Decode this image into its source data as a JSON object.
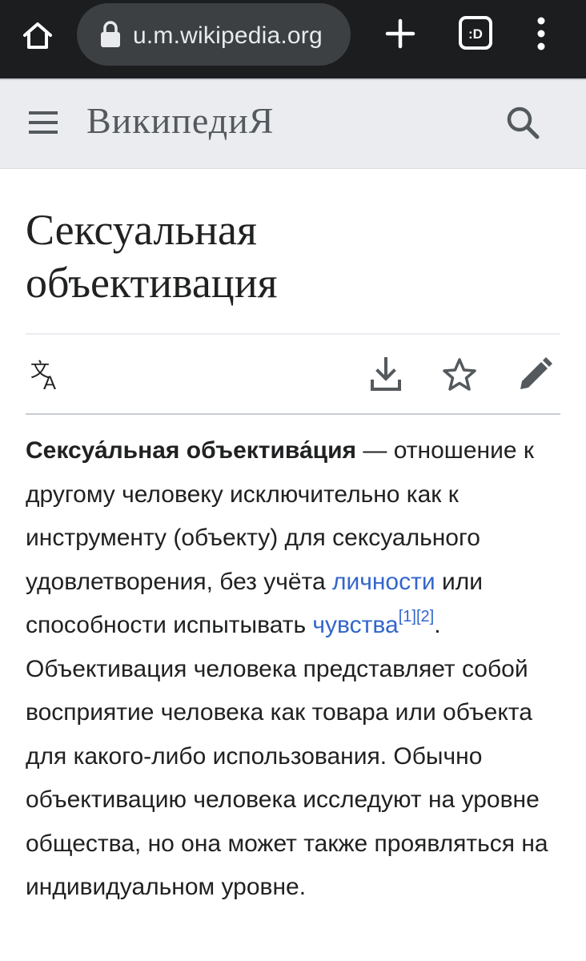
{
  "browser": {
    "url": "u.m.wikipedia.org",
    "icons": [
      "home-icon",
      "lock-icon",
      "plus-icon",
      "tab-switcher-icon",
      "overflow-menu-icon"
    ],
    "tab_label": ":D"
  },
  "header": {
    "wordmark": "ВикипедиЯ",
    "icons": [
      "hamburger-menu-icon",
      "search-icon"
    ]
  },
  "article": {
    "title_line1": "Сексуальная",
    "title_line2": "объективация",
    "actions": [
      "language-icon",
      "download-icon",
      "star-icon",
      "edit-icon"
    ],
    "para": {
      "bold": "Сексуа́льная объектива́ция",
      "t1": " — отношение к другому человеку исключительно как к инструменту (объекту) для сексуального удовлетворения, без учёта ",
      "link1": "личности",
      "t2": " или способности испытывать ",
      "link2": "чувства",
      "ref1": "[1]",
      "ref2": "[2]",
      "t3": ". Объективация человека представляет собой восприятие человека как товара или объекта для какого-либо использования. Обычно объективацию человека исследуют на уровне общества, но она может также проявляться на индивидуальном уровне."
    }
  },
  "colors": {
    "browser_bg": "#1b1d1f",
    "url_pill": "#3c4043",
    "header_bg": "#eaecf0",
    "link": "#3366cc",
    "text": "#202122"
  }
}
